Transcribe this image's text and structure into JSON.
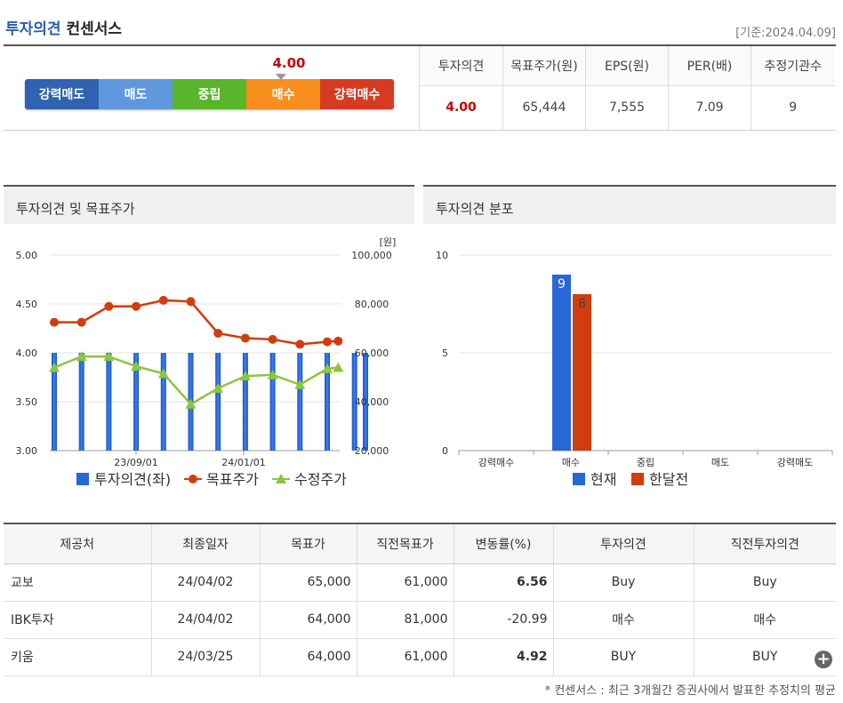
{
  "header": {
    "title_part1": "투자의견",
    "title_part2": "컨센서스",
    "base_date": "[기준:2024.04.09]"
  },
  "opinion_bar": {
    "value": "4.00",
    "level": 4.0,
    "segments": [
      {
        "label": "강력매도",
        "color": "#2f62b0"
      },
      {
        "label": "매도",
        "color": "#5f98de"
      },
      {
        "label": "중립",
        "color": "#59b52a"
      },
      {
        "label": "매수",
        "color": "#f78e1e"
      },
      {
        "label": "강력매수",
        "color": "#d73a22"
      }
    ]
  },
  "summary": {
    "headers": [
      "투자의견",
      "목표주가(원)",
      "EPS(원)",
      "PER(배)",
      "추정기관수"
    ],
    "values": [
      "4.00",
      "65,444",
      "7,555",
      "7.09",
      "9"
    ]
  },
  "panel1_title": "투자의견 및 목표주가",
  "panel2_title": "투자의견 분포",
  "chart_data": [
    {
      "type": "bar+line",
      "unit_label": "[원]",
      "x_tick_labels": [
        "23/09/01",
        "24/01/01"
      ],
      "y_left_ticks": [
        "5.00",
        "4.50",
        "4.00",
        "3.50",
        "3.00"
      ],
      "y_left_lim": [
        3.0,
        5.0
      ],
      "y_right_ticks": [
        "100,000",
        "80,000",
        "60,000",
        "40,000",
        "20,000"
      ],
      "y_right_lim": [
        20000,
        100000
      ],
      "legend": [
        "투자의견(좌)",
        "목표주가",
        "수정주가"
      ],
      "colors": {
        "opinion": "#2867d6",
        "target": "#d23c0f",
        "adjusted": "#8cc63e"
      },
      "opinion": [
        4.0,
        4.0,
        4.0,
        4.0,
        4.0,
        4.0,
        4.0,
        4.0,
        4.0,
        4.0,
        4.0,
        4.0,
        4.0
      ],
      "opinion_x_index": [
        0,
        1,
        2,
        3,
        4,
        5,
        6,
        7,
        8,
        9,
        10,
        11,
        11.4
      ],
      "target_price": [
        72500,
        72500,
        79000,
        79000,
        81500,
        81000,
        68000,
        66000,
        65500,
        63500,
        64500,
        64800
      ],
      "adjusted_price": [
        54000,
        58500,
        58500,
        54500,
        51500,
        39000,
        45500,
        50500,
        51000,
        47000,
        53500,
        54000
      ],
      "line_x_index": [
        0,
        1,
        2,
        3,
        4,
        5,
        6,
        7,
        8,
        9,
        10,
        10.4
      ]
    },
    {
      "type": "bar",
      "categories": [
        "강력매수",
        "매수",
        "중립",
        "매도",
        "강력매도"
      ],
      "series": [
        {
          "name": "현재",
          "values": [
            0,
            9,
            0,
            0,
            0
          ],
          "color": "#2867d6"
        },
        {
          "name": "한달전",
          "values": [
            0,
            8,
            0,
            0,
            0
          ],
          "color": "#d23c0f"
        }
      ],
      "y_ticks": [
        "10",
        "5",
        "0"
      ],
      "ylim": [
        0,
        10
      ]
    }
  ],
  "table": {
    "headers": [
      "제공처",
      "최종일자",
      "목표가",
      "직전목표가",
      "변동률(%)",
      "투자의견",
      "직전투자의견"
    ],
    "rows": [
      [
        "교보",
        "24/04/02",
        "65,000",
        "61,000",
        "6.56",
        "Buy",
        "Buy"
      ],
      [
        "IBK투자",
        "24/04/02",
        "64,000",
        "81,000",
        "-20.99",
        "매수",
        "매수"
      ],
      [
        "키움",
        "24/03/25",
        "64,000",
        "61,000",
        "4.92",
        "BUY",
        "BUY"
      ]
    ]
  },
  "footnote": "* 컨센서스 : 최근 3개월간 증권사에서 발표한 추정치의 평균"
}
